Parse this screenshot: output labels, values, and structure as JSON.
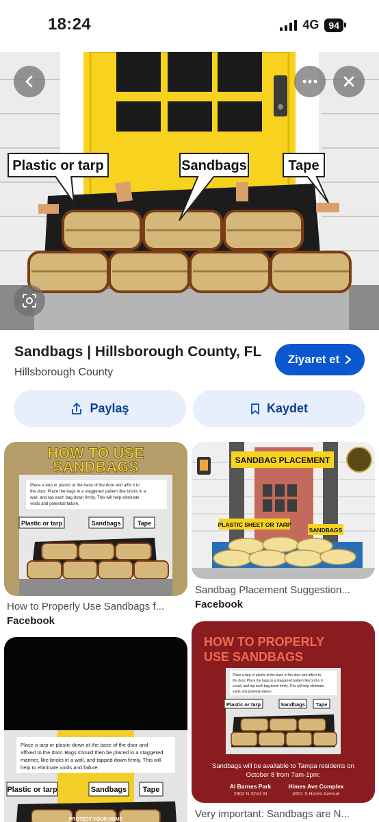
{
  "status_bar": {
    "time": "18:24",
    "network": "4G",
    "battery": "94"
  },
  "hero": {
    "labels": {
      "plastic": "Plastic or tarp",
      "sandbags": "Sandbags",
      "tape": "Tape"
    },
    "colors": {
      "door": "#f7d21f",
      "bag": "#d6b77a",
      "wall": "#e9e9e9"
    }
  },
  "result": {
    "title": "Sandbags | Hillsborough County, FL",
    "source": "Hillsborough County",
    "visit_label": "Ziyaret et",
    "share_label": "Paylaş",
    "save_label": "Kaydet"
  },
  "grid": {
    "card1": {
      "heading_line1": "HOW TO USE",
      "heading_line2": "SANDBAGS",
      "body_text": [
        "Place a tarp or plastic at the base of the door and affix it to",
        "the door. Place the bags in a staggered pattern like bricks in a",
        "wall, and tap each bag down firmly. This will help eliminate",
        "voids and potential failure."
      ],
      "label_plastic": "Plastic or tarp",
      "label_sandbags": "Sandbags",
      "label_tape": "Tape",
      "title": "How to Properly Use Sandbags f...",
      "source": "Facebook"
    },
    "card2": {
      "banner": "SANDBAG PLACEMENT",
      "label_sheet": "PLASTIC SHEET OR TARP",
      "label_sandbags": "SANDBAGS",
      "title": "Sandbag Placement Suggestion...",
      "source": "Facebook"
    },
    "card3": {
      "body_text": [
        "Place a tarp or plastic down at the base of the door and",
        "affixed to the door. Bags should then be placed in a staggered",
        "manner, like bricks in a wall, and tapped down firmly.  This will",
        "help to eliminate voids and failure."
      ],
      "label_plastic": "Plastic or tarp",
      "label_sandbags": "Sandbags",
      "label_tape": "Tape",
      "footer": "PROTECT YOUR HOME"
    },
    "card4": {
      "heading_line1": "HOW TO PROPERLY",
      "heading_line2": "USE SANDBAGS",
      "body_text": [
        "Place a tarp or plastic at the base of the door and affix it to",
        "the door. Place the bags in a staggered pattern like bricks in",
        "a wall, and tap each bag down firmly. This will help eliminate",
        "voids and potential failure."
      ],
      "label_plastic": "Plastic or tarp",
      "label_sandbags": "Sandbags",
      "label_tape": "Tape",
      "notice_line1": "Sandbags will be available to Tampa residents on",
      "notice_line2": "October 8 from 7am-1pm:",
      "loc1_name": "Al Barnes Park",
      "loc1_addr": "2902 N 32nd St",
      "loc2_name": "Himes Ave Complex",
      "loc2_addr": "4501 S Himes Avenue",
      "title": "Very important: Sandbags are N..."
    }
  }
}
